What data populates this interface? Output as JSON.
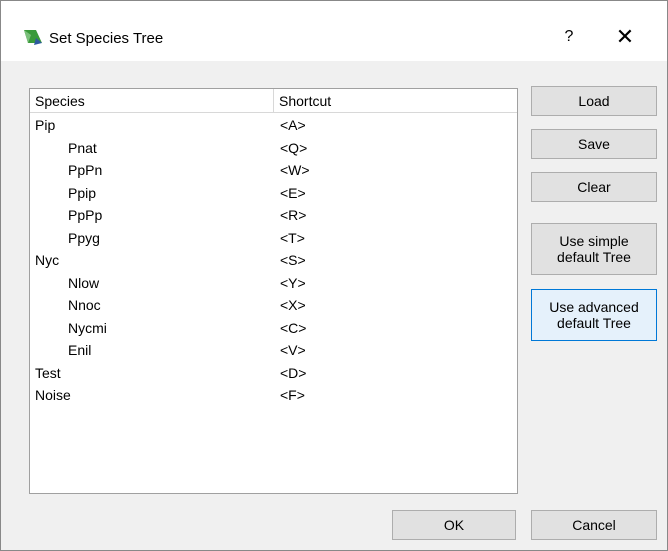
{
  "window": {
    "title": "Set Species Tree",
    "help_label": "?",
    "close_label": "✕"
  },
  "tree": {
    "headers": {
      "species": "Species",
      "shortcut": "Shortcut"
    },
    "rows": [
      {
        "species": "Pip",
        "shortcut": "<A>",
        "level": 0
      },
      {
        "species": "Pnat",
        "shortcut": "<Q>",
        "level": 1
      },
      {
        "species": "PpPn",
        "shortcut": "<W>",
        "level": 1
      },
      {
        "species": "Ppip",
        "shortcut": "<E>",
        "level": 1
      },
      {
        "species": "PpPp",
        "shortcut": "<R>",
        "level": 1
      },
      {
        "species": "Ppyg",
        "shortcut": "<T>",
        "level": 1
      },
      {
        "species": "Nyc",
        "shortcut": "<S>",
        "level": 0
      },
      {
        "species": "Nlow",
        "shortcut": "<Y>",
        "level": 1
      },
      {
        "species": "Nnoc",
        "shortcut": "<X>",
        "level": 1
      },
      {
        "species": "Nycmi",
        "shortcut": "<C>",
        "level": 1
      },
      {
        "species": "Enil",
        "shortcut": "<V>",
        "level": 1
      },
      {
        "species": "Test",
        "shortcut": "<D>",
        "level": 0
      },
      {
        "species": "Noise",
        "shortcut": "<F>",
        "level": 0
      }
    ]
  },
  "buttons": {
    "load": "Load",
    "save": "Save",
    "clear": "Clear",
    "simple_line1": "Use simple",
    "simple_line2": "default Tree",
    "advanced_line1": "Use advanced",
    "advanced_line2": "default Tree",
    "ok": "OK",
    "cancel": "Cancel"
  },
  "colors": {
    "focus_border": "#0078d7",
    "focus_fill": "#e5f1fb",
    "app_icon": "#3a9a3a"
  }
}
